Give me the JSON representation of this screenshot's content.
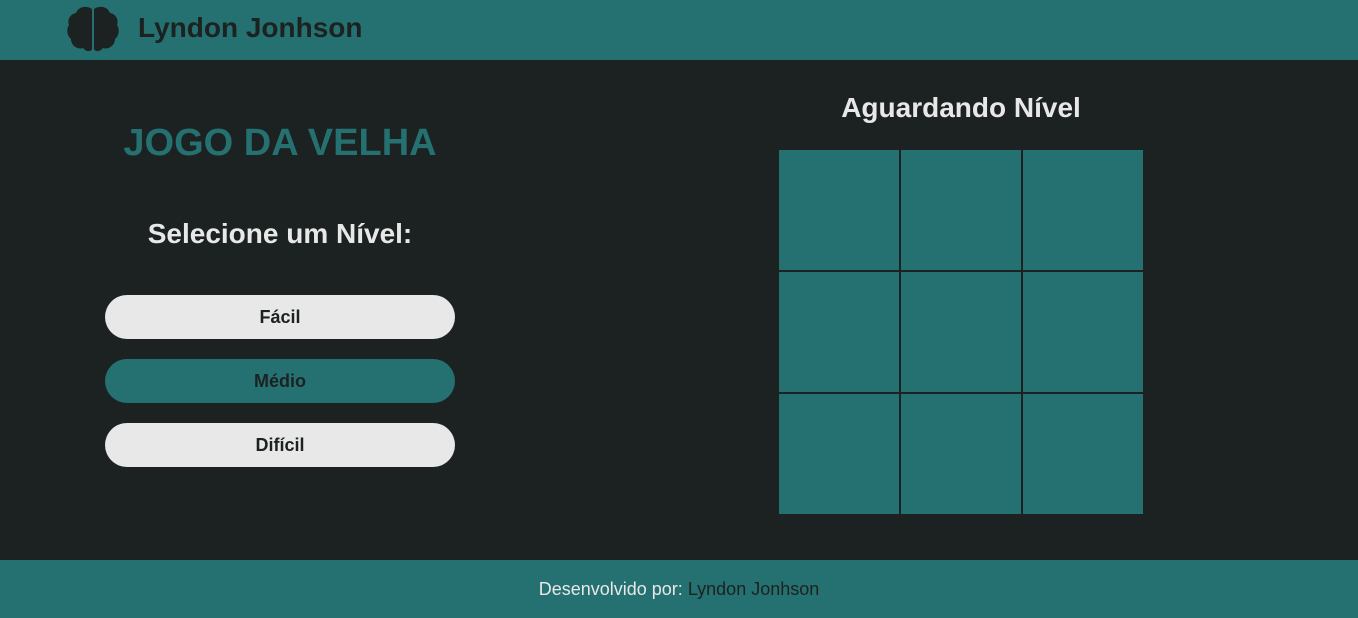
{
  "header": {
    "logo_icon": "brain-icon",
    "brand": "Lyndon Jonhson"
  },
  "game": {
    "title": "JOGO DA VELHA",
    "level_prompt": "Selecione um Nível:",
    "levels": [
      {
        "label": "Fácil",
        "selected": false
      },
      {
        "label": "Médio",
        "selected": true
      },
      {
        "label": "Difícil",
        "selected": false
      }
    ],
    "status": "Aguardando Nível",
    "board": [
      "",
      "",
      "",
      "",
      "",
      "",
      "",
      "",
      ""
    ]
  },
  "footer": {
    "prefix": "Desenvolvido por:",
    "author": "Lyndon Jonhson"
  },
  "colors": {
    "accent": "#257070",
    "background": "#1c2221",
    "light": "#e8e8e8"
  }
}
